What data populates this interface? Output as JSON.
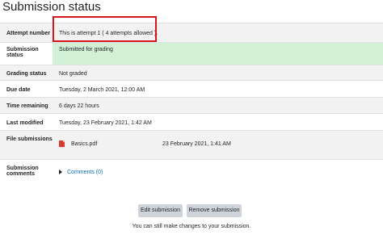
{
  "page": {
    "heading": "Submission status"
  },
  "rows": {
    "attempt": {
      "label": "Attempt number",
      "value": "This is attempt 1 ( 4 attempts allowed )."
    },
    "status": {
      "label": "Submission status",
      "value": "Submitted for grading"
    },
    "grading": {
      "label": "Grading status",
      "value": "Not graded"
    },
    "due": {
      "label": "Due date",
      "value": "Tuesday, 2 March 2021, 12:00 AM"
    },
    "remaining": {
      "label": "Time remaining",
      "value": "6 days 22 hours"
    },
    "modified": {
      "label": "Last modified",
      "value": "Tuesday, 23 February 2021, 1:42 AM"
    },
    "files": {
      "label": "File submissions",
      "file_name": "Basics.pdf",
      "file_date": "23 February 2021, 1:41 AM"
    },
    "comments": {
      "label": "Submission comments",
      "link": "Comments (0)"
    }
  },
  "actions": {
    "edit": "Edit submission",
    "remove": "Remove submission",
    "note": "You can still make changes to your submission."
  },
  "colors": {
    "highlight_border": "#d6161d",
    "submitted_bg": "#d2f0d5",
    "shade_bg": "#f2f2f2"
  }
}
